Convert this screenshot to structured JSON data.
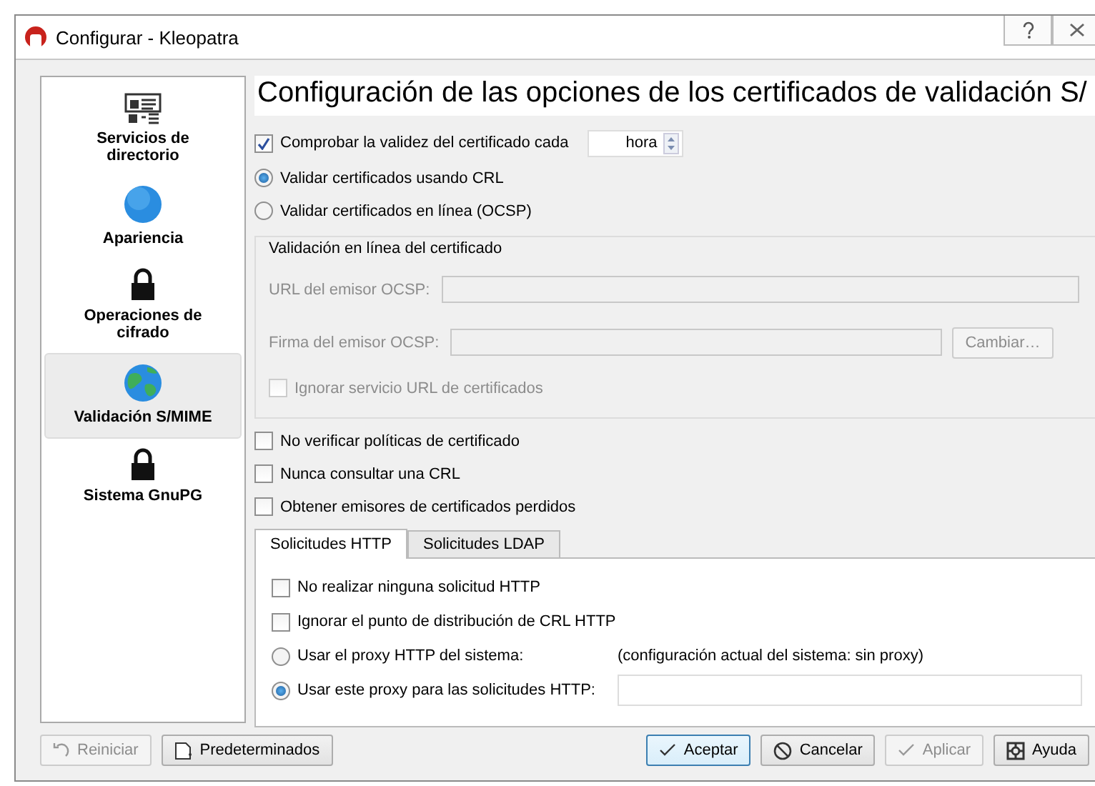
{
  "window": {
    "title": "Configurar - Kleopatra"
  },
  "sidebar": {
    "items": [
      {
        "label": "Servicios de directorio",
        "kind": "directory",
        "selected": false
      },
      {
        "label": "Apariencia",
        "kind": "sphere",
        "selected": false
      },
      {
        "label": "Operaciones de cifrado",
        "kind": "lock",
        "selected": false
      },
      {
        "label": "Validación S/MIME",
        "kind": "earth",
        "selected": true
      },
      {
        "label": "Sistema GnuPG",
        "kind": "lock",
        "selected": false
      }
    ]
  },
  "page": {
    "title": "Configuración de las opciones de los certificados de validación S/",
    "options": [
      {
        "kind": "checkbox",
        "label": "Comprobar la validez del certificado cada",
        "checked": true,
        "spin_value": "hora"
      },
      {
        "kind": "radio",
        "label": "Validar certificados usando CRL",
        "selected": true
      },
      {
        "kind": "radio",
        "label": "Validar certificados en línea (OCSP)",
        "selected": false
      }
    ],
    "ocsp_group": {
      "title": "Validación en línea del certificado",
      "disabled": true,
      "fields": [
        {
          "label": "URL del emisor OCSP:"
        },
        {
          "label": "Firma del emisor OCSP:",
          "button": "Cambiar…"
        }
      ],
      "checkbox": {
        "label": "Ignorar servicio URL de certificados",
        "checked": false
      }
    },
    "more_options": [
      {
        "label": "No verificar políticas de certificado",
        "checked": false
      },
      {
        "label": "Nunca consultar una CRL",
        "checked": false
      },
      {
        "label": "Obtener emisores de certificados perdidos",
        "checked": false
      }
    ],
    "tabs": [
      {
        "label": "Solicitudes HTTP",
        "selected": true
      },
      {
        "label": "Solicitudes LDAP",
        "selected": false
      }
    ],
    "http": [
      {
        "kind": "checkbox",
        "label": "No realizar ninguna solicitud HTTP",
        "checked": false
      },
      {
        "kind": "checkbox",
        "label": "Ignorar el punto de distribución de CRL HTTP",
        "checked": false
      },
      {
        "kind": "radio",
        "label": "Usar el proxy HTTP del sistema:",
        "selected": false,
        "note": "(configuración actual del sistema: sin proxy)"
      },
      {
        "kind": "radio",
        "label": "Usar este proxy para las solicitudes HTTP:",
        "selected": true,
        "input": true
      }
    ]
  },
  "footer": {
    "left": [
      {
        "label": "Reiniciar",
        "kind": "reset",
        "disabled": true,
        "default": false
      },
      {
        "label": "Predeterminados",
        "kind": "defaults",
        "disabled": false,
        "default": false
      }
    ],
    "right": [
      {
        "label": "Aceptar",
        "kind": "ok",
        "disabled": false,
        "default": true
      },
      {
        "label": "Cancelar",
        "kind": "cancel",
        "disabled": false,
        "default": false
      },
      {
        "label": "Aplicar",
        "kind": "ok",
        "disabled": true,
        "default": false
      },
      {
        "label": "Ayuda",
        "kind": "help",
        "disabled": false,
        "default": false
      }
    ]
  }
}
